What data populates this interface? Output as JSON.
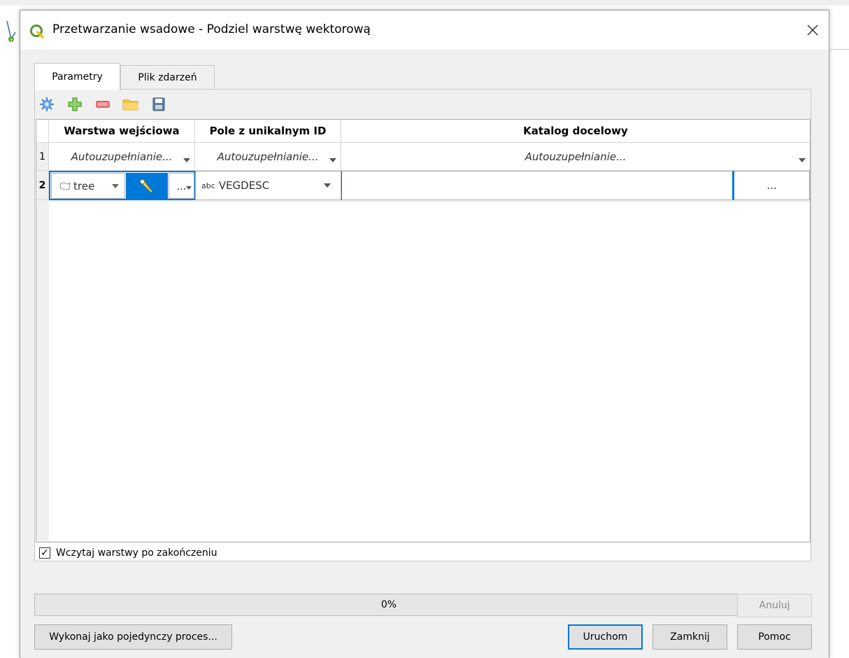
{
  "dialog": {
    "title": "Przetwarzanie wsadowe - Podziel warstwę wektorową",
    "tabs": [
      {
        "label": "Parametry",
        "active": true
      },
      {
        "label": "Plik zdarzeń",
        "active": false
      }
    ],
    "toolbar": {
      "icons": [
        "autofill-gear-icon",
        "add-row-icon",
        "remove-row-icon",
        "open-folder-icon",
        "save-icon"
      ]
    },
    "table": {
      "columns": [
        "Warstwa wejściowa",
        "Pole z unikalnym ID",
        "Katalog docelowy"
      ],
      "autofill_row": {
        "number": "1",
        "cells": [
          "Autouzupełnianie...",
          "Autouzupełnianie...",
          "Autouzupełnianie..."
        ]
      },
      "data_row": {
        "number": "2",
        "layer_value": "tree",
        "layer_ellipsis": "...",
        "field_prefix": "abc",
        "field_value": "VEGDESC",
        "output_value": "",
        "browse_label": "..."
      }
    },
    "load_layers": {
      "label": "Wczytaj warstwy po zakończeniu",
      "checked": true,
      "check_mark": "✓"
    },
    "progress": {
      "text": "0%",
      "value": 0
    },
    "buttons": {
      "cancel": "Anuluj",
      "run_single": "Wykonaj jako pojedynczy proces...",
      "run": "Uruchom",
      "close": "Zamknij",
      "help": "Pomoc"
    },
    "colors": {
      "accent": "#0078d7",
      "qgis_green": "#589632",
      "qgis_yellow": "#f0c000"
    }
  }
}
